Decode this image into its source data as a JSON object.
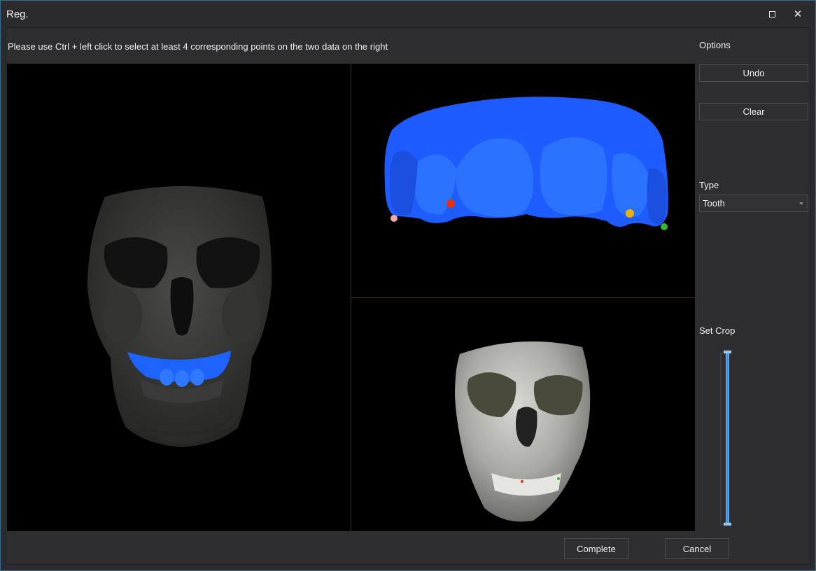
{
  "window": {
    "title": "Reg."
  },
  "instruction": "Please use Ctrl + left click to select at least 4 corresponding points on the two data on the right",
  "options": {
    "heading": "Options",
    "undo_label": "Undo",
    "clear_label": "Clear",
    "type_label": "Type",
    "type_value": "Tooth",
    "crop_label": "Set Crop"
  },
  "footer": {
    "complete_label": "Complete",
    "cancel_label": "Cancel"
  },
  "icons": {
    "maximize": "maximize-icon",
    "close": "close-icon",
    "dropdown": "chevron-down-icon"
  },
  "colors": {
    "scan_blue": "#1f63ff",
    "point_red": "#e8300f",
    "point_yellow": "#f0b400",
    "point_green": "#39b636",
    "point_pink": "#f0a8a8",
    "slider_accent": "#2f8ee0"
  }
}
